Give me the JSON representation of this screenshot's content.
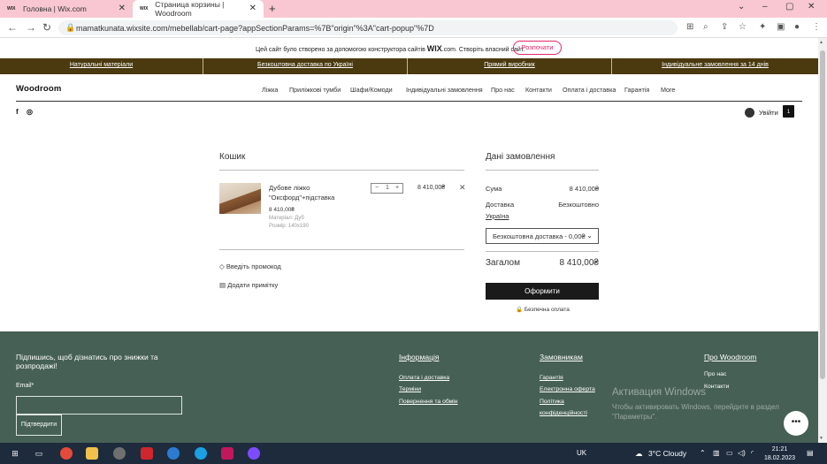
{
  "browser": {
    "tabs": [
      {
        "icon": "WIX",
        "title": "Головна | Wix.com"
      },
      {
        "icon": "WIX",
        "title": "Страница корзины | Woodroom"
      }
    ],
    "new_tab": "+",
    "url": "mamatkunata.wixsite.com/mebellab/cart-page?appSectionParams=%7B\"origin\"%3A\"cart-popup\"%7D"
  },
  "wix_banner": {
    "text": "Цей сайт було створено за допомогою конструктора сайтів",
    "brand": "WIX",
    "brand_suffix": ".com",
    "cta_text": "Створіть власний сайт.",
    "button": "Розпочати"
  },
  "promo_bar": [
    "Натуральні матеріали",
    "Безкоштовна доставка по Україні",
    "Прямий виробник",
    "Індивідуальне замовлення за 14 днів"
  ],
  "header": {
    "logo": "Woodroom",
    "nav": [
      "Ліжка",
      "Приліжкові тумби",
      "Шафи/Комоди",
      "Індивідуальні замовлення",
      "Про нас",
      "Контакти",
      "Оплата і доставка",
      "Гарантія",
      "More"
    ],
    "social": [
      "facebook-icon",
      "instagram-icon"
    ],
    "login": "Увійти",
    "cart_count": "1"
  },
  "cart": {
    "title": "Кошик",
    "item": {
      "name": "Дубове ліжко \"Оксфорд\"+підставка",
      "price": "8 410,00₴",
      "attributes": [
        "Матеріал: Дуб",
        "Розмір: 140х190"
      ],
      "quantity": "1",
      "total": "8 410,00₴"
    },
    "promo_link": "Введіть промокод",
    "note_link": "Додати примітку"
  },
  "order": {
    "title": "Дані замовлення",
    "sum_label": "Сума",
    "sum_value": "8 410,00₴",
    "delivery_label": "Доставка",
    "delivery_value": "Безкоштовно",
    "country": "Україна",
    "delivery_option": "Безкоштовна доставка - 0,00₴",
    "total_label": "Загалом",
    "total_value": "8 410,00₴",
    "checkout_button": "Оформити",
    "secure_text": "Безпечна оплата"
  },
  "footer": {
    "subscribe_title": "Підпишись, щоб дізнатись про знижки та розпродажі!",
    "email_label": "Email*",
    "submit_button": "Підтвердити",
    "columns": [
      {
        "title": "Інформація",
        "links": [
          "Оплата і доставка",
          "Терміни",
          "Повернення та обмін"
        ]
      },
      {
        "title": "Замовникам",
        "links": [
          "Гарантія",
          "Електронна оферта",
          "Політика",
          "конфіденційності"
        ]
      },
      {
        "title": "Про Woodroom",
        "links": [
          "Про нас",
          "Контакти"
        ]
      }
    ],
    "activation_title": "Активация Windows",
    "activation_text": "Чтобы активировать Windows, перейдите в раздел \"Параметры\"."
  },
  "taskbar": {
    "language": "UK",
    "weather": "3°C  Cloudy",
    "time": "21:21",
    "date": "18.02.2023"
  }
}
